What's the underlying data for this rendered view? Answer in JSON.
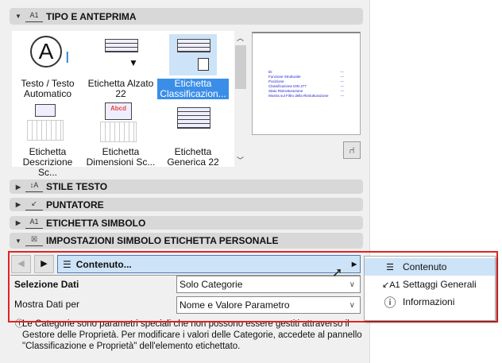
{
  "sections": {
    "tipo": "TIPO E ANTEPRIMA",
    "stile": "STILE TESTO",
    "puntatore": "PUNTATORE",
    "simbolo": "ETICHETTA SIMBOLO",
    "impostazioni": "IMPOSTAZIONI SIMBOLO ETICHETTA PERSONALE"
  },
  "grid_items": [
    {
      "l1": "Testo / Testo",
      "l2": "Automatico"
    },
    {
      "l1": "Etichetta Alzato",
      "l2": "22"
    },
    {
      "l1": "Etichetta",
      "l2": "Classificazion..."
    },
    {
      "l1": "Etichetta",
      "l2": "Descrizione Sc..."
    },
    {
      "l1": "Etichetta",
      "l2": "Dimensioni Sc..."
    },
    {
      "l1": "Etichetta",
      "l2": "Generica 22"
    }
  ],
  "thumb_text": {
    "abcd": "Abcd"
  },
  "preview": {
    "lines": [
      "ID",
      "Funzione Strutturale",
      "Posizione",
      "Classificazione DIN 277",
      "Stato Ristrutturazione",
      "Mostra sul Filtro della Ristrutturazione"
    ],
    "value": "---"
  },
  "nav": {
    "page_label": "Contenuto..."
  },
  "fields": {
    "selezione_label": "Selezione Dati",
    "selezione_value": "Solo Categorie",
    "mostra_label": "Mostra Dati per",
    "mostra_value": "Nome e Valore Parametro"
  },
  "menu": [
    "Contenuto",
    "Settaggi Generali",
    "Informazioni"
  ],
  "info_text": "Le Categorie sono parametri speciali che non possono essere gestiti attraverso il Gestore delle Proprietà. Per modificare i valori delle Categorie, accedete al pannello \"Classificazione e Proprietà\" dell'elemento etichettato."
}
